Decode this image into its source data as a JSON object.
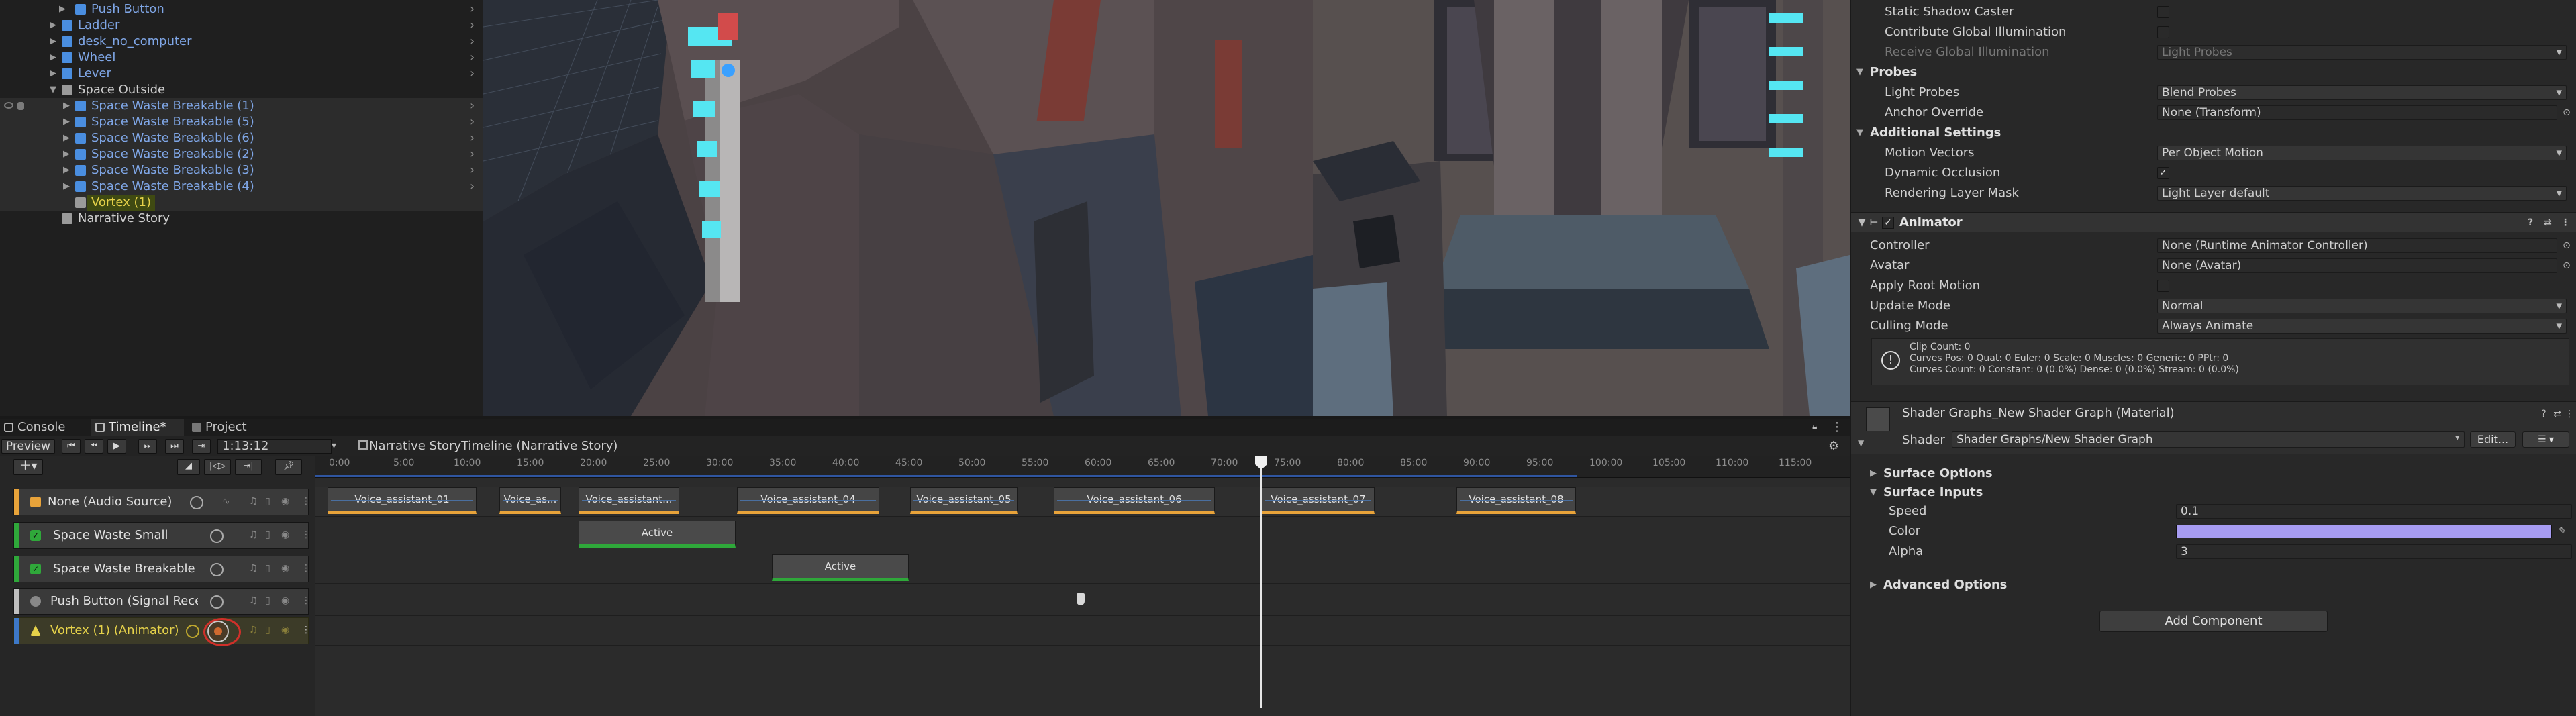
{
  "hierarchy": {
    "items": [
      {
        "label": "Push Button",
        "level": 2,
        "expandable": true
      },
      {
        "label": "Ladder",
        "level": 1,
        "expandable": true
      },
      {
        "label": "desk_no_computer",
        "level": 1,
        "expandable": true
      },
      {
        "label": "Wheel",
        "level": 1,
        "expandable": true
      },
      {
        "label": "Lever",
        "level": 1,
        "expandable": true
      },
      {
        "label": "Space Outside",
        "level": 1,
        "expandable": true,
        "expanded": true
      },
      {
        "label": "Space Waste Breakable (1)",
        "level": 2,
        "expandable": true
      },
      {
        "label": "Space Waste Breakable (5)",
        "level": 2,
        "expandable": true
      },
      {
        "label": "Space Waste Breakable (6)",
        "level": 2,
        "expandable": true
      },
      {
        "label": "Space Waste Breakable (2)",
        "level": 2,
        "expandable": true
      },
      {
        "label": "Space Waste Breakable (3)",
        "level": 2,
        "expandable": true
      },
      {
        "label": "Space Waste Breakable (4)",
        "level": 2,
        "expandable": true
      },
      {
        "label": "Vortex (1)",
        "level": 2,
        "expandable": false
      },
      {
        "label": "Narrative Story",
        "level": 0,
        "expandable": false
      }
    ]
  },
  "tabs": {
    "console": "Console",
    "timeline": "Timeline*",
    "project": "Project"
  },
  "timeline": {
    "preview_label": "Preview",
    "current_time": "1:13:12",
    "asset_name": "Narrative StoryTimeline (Narrative Story)",
    "ruler": [
      "0:00",
      "5:00",
      "10:00",
      "15:00",
      "20:00",
      "25:00",
      "30:00",
      "35:00",
      "40:00",
      "45:00",
      "50:00",
      "55:00",
      "60:00",
      "65:00",
      "70:00",
      "75:00",
      "80:00",
      "85:00",
      "90:00",
      "95:00",
      "100:00",
      "105:00",
      "110:00",
      "115:00"
    ],
    "tracks": [
      {
        "name": "None (Audio Source)",
        "color": "#e8a33a"
      },
      {
        "name": "Space Waste Small",
        "color": "#2fa83a"
      },
      {
        "name": "Space Waste Breakable",
        "color": "#2fa83a"
      },
      {
        "name": "Push Button (Signal Receiv",
        "color": "#bfbfbf"
      },
      {
        "name": "Vortex (1) (Animator)",
        "color": "#e6d24a"
      }
    ],
    "audio_clips": [
      "Voice_assistant_01",
      "Voice_as...",
      "Voice_assistant...",
      "Voice_assistant_04",
      "Voice_assistant_05",
      "Voice_assistant_06",
      "Voice_assistant_07",
      "Voice_assistant_08"
    ],
    "activation_clips": [
      "Active",
      "Active"
    ]
  },
  "inspector": {
    "lighting": {
      "static_shadow_caster": "Static Shadow Caster",
      "contribute_gi": "Contribute Global Illumination",
      "receive_gi": "Receive Global Illumination",
      "receive_gi_value": "Light Probes"
    },
    "probes": {
      "header": "Probes",
      "light_probes": "Light Probes",
      "light_probes_value": "Blend Probes",
      "anchor_override": "Anchor Override",
      "anchor_override_value": "None (Transform)"
    },
    "additional": {
      "header": "Additional Settings",
      "motion_vectors": "Motion Vectors",
      "motion_vectors_value": "Per Object Motion",
      "dynamic_occlusion": "Dynamic Occlusion",
      "rendering_layer_mask": "Rendering Layer Mask",
      "rendering_layer_mask_value": "Light Layer default"
    },
    "animator": {
      "title": "Animator",
      "controller": "Controller",
      "controller_value": "None (Runtime Animator Controller)",
      "avatar": "Avatar",
      "avatar_value": "None (Avatar)",
      "apply_root_motion": "Apply Root Motion",
      "update_mode": "Update Mode",
      "update_mode_value": "Normal",
      "culling_mode": "Culling Mode",
      "culling_mode_value": "Always Animate",
      "info_line1": "Clip Count: 0",
      "info_line2": "Curves Pos: 0 Quat: 0 Euler: 0 Scale: 0 Muscles: 0 Generic: 0 PPtr: 0",
      "info_line3": "Curves Count: 0 Constant: 0 (0.0%) Dense: 0 (0.0%) Stream: 0 (0.0%)"
    },
    "material": {
      "title": "Shader Graphs_New Shader Graph (Material)",
      "shader_label": "Shader",
      "shader_value": "Shader Graphs/New Shader Graph",
      "edit_button": "Edit...",
      "surface_options": "Surface Options",
      "surface_inputs": "Surface Inputs",
      "speed": "Speed",
      "speed_value": "0.1",
      "color": "Color",
      "color_value": "#a79cf2",
      "alpha": "Alpha",
      "alpha_value": "3",
      "advanced_options": "Advanced Options"
    },
    "add_component": "Add Component"
  }
}
